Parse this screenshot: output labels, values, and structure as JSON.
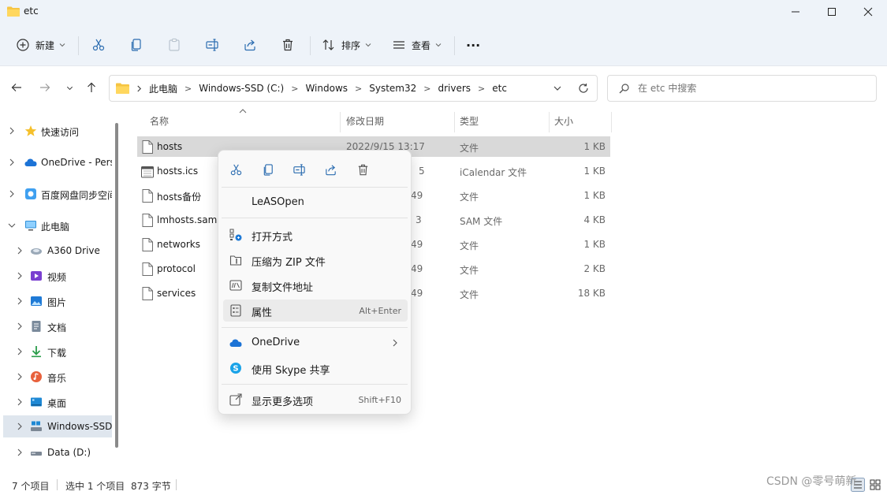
{
  "window": {
    "title": "etc"
  },
  "toolbar": {
    "new_label": "新建",
    "sort_label": "排序",
    "view_label": "查看",
    "more_label": "···"
  },
  "address": {
    "crumbs": [
      "此电脑",
      "Windows-SSD (C:)",
      "Windows",
      "System32",
      "drivers",
      "etc"
    ]
  },
  "search": {
    "placeholder": "在 etc 中搜索"
  },
  "sidebar": {
    "items": [
      {
        "label": "快速访问",
        "icon": "star-icon"
      },
      {
        "label": "OneDrive - Pers",
        "icon": "cloud-icon"
      },
      {
        "label": "百度网盘同步空间",
        "icon": "baidu-icon"
      },
      {
        "label": "此电脑",
        "icon": "computer-icon"
      },
      {
        "label": "A360 Drive",
        "icon": "a360-icon"
      },
      {
        "label": "视频",
        "icon": "video-icon"
      },
      {
        "label": "图片",
        "icon": "picture-icon"
      },
      {
        "label": "文档",
        "icon": "document-icon"
      },
      {
        "label": "下载",
        "icon": "download-icon"
      },
      {
        "label": "音乐",
        "icon": "music-icon"
      },
      {
        "label": "桌面",
        "icon": "desktop-icon"
      },
      {
        "label": "Windows-SSD",
        "icon": "drive-icon"
      },
      {
        "label": "Data (D:)",
        "icon": "drive-icon"
      }
    ]
  },
  "columns": {
    "name": "名称",
    "date": "修改日期",
    "type": "类型",
    "size": "大小"
  },
  "files": [
    {
      "name": "hosts",
      "date": "2022/9/15 13:17",
      "type": "文件",
      "size": "1 KB"
    },
    {
      "name": "hosts.ics",
      "date": "5",
      "type": "iCalendar 文件",
      "size": "1 KB"
    },
    {
      "name": "hosts备份",
      "date": "49",
      "type": "文件",
      "size": "1 KB"
    },
    {
      "name": "lmhosts.sam",
      "date": "3",
      "type": "SAM 文件",
      "size": "4 KB"
    },
    {
      "name": "networks",
      "date": "49",
      "type": "文件",
      "size": "1 KB"
    },
    {
      "name": "protocol",
      "date": "49",
      "type": "文件",
      "size": "2 KB"
    },
    {
      "name": "services",
      "date": "49",
      "type": "文件",
      "size": "18 KB"
    }
  ],
  "context_menu": {
    "leasopen": "LeASOpen",
    "open_with": "打开方式",
    "zip": "压缩为 ZIP 文件",
    "copy_path": "复制文件地址",
    "properties": "属性",
    "properties_key": "Alt+Enter",
    "onedrive": "OneDrive",
    "skype": "使用 Skype 共享",
    "more_options": "显示更多选项",
    "more_options_key": "Shift+F10"
  },
  "status": {
    "count": "7 个项目",
    "selected": "选中 1 个项目",
    "size": "873 字节"
  },
  "watermark": "CSDN @零号萌新"
}
